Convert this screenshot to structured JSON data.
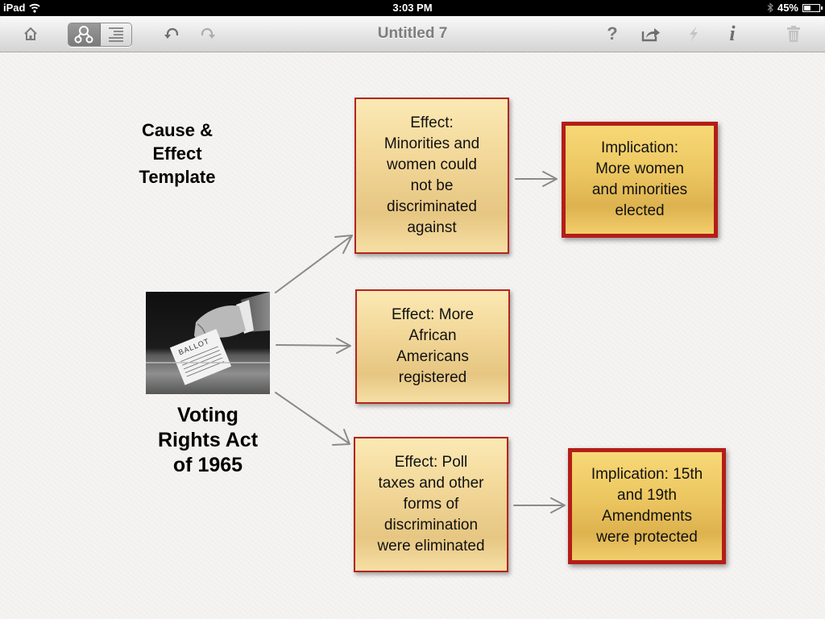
{
  "statusbar": {
    "device": "iPad",
    "time": "3:03 PM",
    "battery_percent_label": "45%",
    "battery_level": 0.45
  },
  "toolbar": {
    "title": "Untitled 7",
    "icons": {
      "home": "home-icon",
      "diagram_view": "diagram-view-icon",
      "outline_view": "outline-view-icon",
      "undo": "undo-icon",
      "redo": "redo-icon",
      "help": "help-icon",
      "share": "share-icon",
      "action": "lightning-icon",
      "info": "info-icon",
      "trash": "trash-icon"
    },
    "help_glyph": "?",
    "info_glyph": "i"
  },
  "diagram": {
    "heading": [
      "Cause &",
      "Effect",
      "Template"
    ],
    "cause": {
      "image_label": "BALLOT",
      "title": [
        "Voting",
        "Rights Act",
        "of 1965"
      ]
    },
    "effects": [
      {
        "lines": [
          "Effect:",
          "Minorities and",
          "women could",
          "not be",
          "discriminated",
          "against"
        ]
      },
      {
        "lines": [
          "Effect: More",
          "African",
          "Americans",
          "registered"
        ]
      },
      {
        "lines": [
          "Effect: Poll",
          "taxes and other",
          "forms of",
          "discrimination",
          "were eliminated"
        ]
      }
    ],
    "implications": [
      {
        "lines": [
          "Implication:",
          "More women",
          "and minorities",
          "elected"
        ]
      },
      {
        "lines": [
          "Implication: 15th",
          "and 19th",
          "Amendments",
          "were protected"
        ]
      }
    ],
    "colors": {
      "border_red": "#b3251f",
      "effect_fill": "#f3d99b",
      "implication_fill": "#edc862",
      "arrow": "#8a8a8a"
    }
  }
}
